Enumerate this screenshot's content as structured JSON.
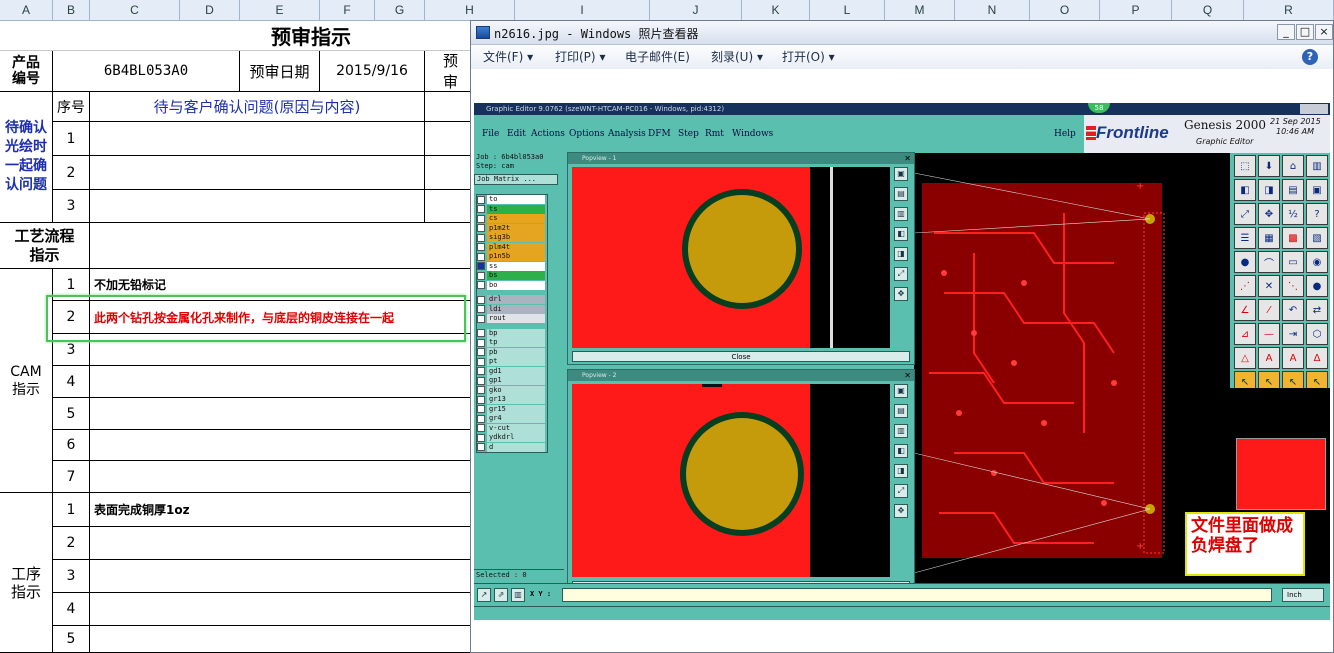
{
  "sheet": {
    "columns": [
      "A",
      "B",
      "C",
      "D",
      "E",
      "F",
      "G",
      "H",
      "I",
      "J",
      "K",
      "L",
      "M",
      "N",
      "O",
      "P",
      "Q",
      "R"
    ],
    "title": "预审指示",
    "product_label": "产品编号",
    "product_value": "6B4BL053A0",
    "review_date_label": "预审日期",
    "review_date_value": "2015/9/16",
    "review_cut": "预审",
    "seq_header": "序号",
    "issue_header": "待与客户确认问题(原因与内容)",
    "pending_group_label": "待确认光绘时一起确认问题",
    "pending_rows": [
      "1",
      "2",
      "3"
    ],
    "process_label": "工艺流程指示",
    "cam_label": "CAM指示",
    "cam_rows": [
      {
        "num": "1",
        "text": "不加无铅标记"
      },
      {
        "num": "2",
        "text": "此两个钻孔按金属化孔来制作，与底层的铜皮连接在一起"
      },
      {
        "num": "3",
        "text": ""
      },
      {
        "num": "4",
        "text": ""
      },
      {
        "num": "5",
        "text": ""
      },
      {
        "num": "6",
        "text": ""
      },
      {
        "num": "7",
        "text": ""
      }
    ],
    "step_label": "工序指示",
    "step_rows": [
      {
        "num": "1",
        "text": "表面完成铜厚1oz"
      },
      {
        "num": "2",
        "text": ""
      },
      {
        "num": "3",
        "text": ""
      },
      {
        "num": "4",
        "text": ""
      },
      {
        "num": "5",
        "text": ""
      }
    ]
  },
  "viewer": {
    "title": "n2616.jpg - Windows 照片查看器",
    "menu": [
      "文件(F)",
      "打印(P)",
      "电子邮件(E)",
      "刻录(U)",
      "打开(O)"
    ],
    "help": "?"
  },
  "genesis": {
    "window_title": "Graphic Editor 9.0762 (szeWNT-HTCAM-PC016 - Windows, pid:4312)",
    "menu": [
      "File",
      "Edit",
      "Actions",
      "Options",
      "Analysis",
      "DFM",
      "Step",
      "Rmt",
      "Windows"
    ],
    "help": "Help",
    "brand": "Frontline",
    "product": "Genesis 2000",
    "product_sub": "Graphic Editor",
    "date": "21 Sep 2015",
    "time": "10:46 AM",
    "job": "Job : 6b4bl053a0",
    "step": "Step: cam",
    "job_matrix": "Job Matrix ...",
    "layers_top": [
      "to",
      "ts",
      "cs",
      "p1m2t",
      "sig3b",
      "plm4t",
      "p1n5b",
      "ss",
      "bs",
      "bo"
    ],
    "layers_mid": [
      "drl",
      "ldi",
      "rout"
    ],
    "layers_bot": [
      "bp",
      "tp",
      "pb",
      "pt",
      "gd1",
      "gp1",
      "gko",
      "gr13",
      "gr15",
      "gr4",
      "v-cut",
      "ydkdrl",
      "d"
    ],
    "selected": "Selected : 0",
    "popview1_title": "Popview - 1",
    "popview2_title": "Popview - 2",
    "close": "Close",
    "xy_label": "X Y :",
    "unit": "Inch",
    "badge": "58"
  },
  "annotation": {
    "note": "文件里面做成负焊盘了"
  }
}
